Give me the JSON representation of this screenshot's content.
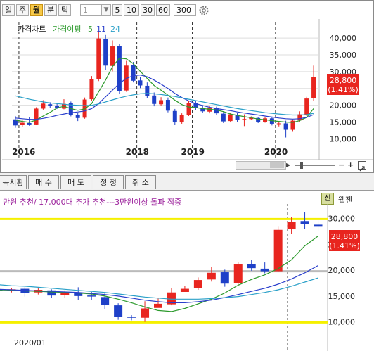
{
  "toolbar": {
    "periods": [
      "일",
      "주",
      "월",
      "분",
      "틱"
    ],
    "selected_period": "월",
    "unit_value": "1",
    "quick_units": [
      "5",
      "10",
      "30",
      "60"
    ],
    "count_value": "300"
  },
  "top_chart": {
    "legend": [
      {
        "label": "가격차트",
        "color": "#111111"
      },
      {
        "label": "가격이평",
        "color": "#2c9a2c"
      },
      {
        "label": "5",
        "color": "#2c9a2c"
      },
      {
        "label": "11",
        "color": "#2b3fcc"
      },
      {
        "label": "24",
        "color": "#2aa0c8"
      }
    ],
    "price_badge": "28,800",
    "change_badge": "(1.41%)"
  },
  "tabs": [
    "독시황",
    "매 수",
    "매 도",
    "정 정",
    "취 소"
  ],
  "bottom_panel": {
    "note": "만원 추천/ 17,000대 추가 추천---3만원이상 돌파 적중",
    "fav_label": "신",
    "web_label": "웹젠",
    "price_badge": "28,800",
    "change_badge": "(1.41%)"
  },
  "chart_data": [
    {
      "type": "candlestick",
      "title": "",
      "x_tick_labels": [
        "2016",
        "2018",
        "2019",
        "2020"
      ],
      "y_tick_labels": [
        "10,000",
        "15,000",
        "20,000",
        "25,000",
        "30,000",
        "35,000",
        "40,000"
      ],
      "ylim": [
        8000,
        44000
      ],
      "up_color": "#e8251f",
      "down_color": "#1e40c8",
      "candles": [
        [
          15800,
          14000,
          16800,
          13300
        ],
        [
          14200,
          14800,
          15700,
          13600
        ],
        [
          14700,
          14300,
          16400,
          13900
        ],
        [
          14300,
          19000,
          19400,
          14100
        ],
        [
          19000,
          20500,
          21500,
          18700
        ],
        [
          20300,
          19900,
          20900,
          19200
        ],
        [
          19800,
          19300,
          20500,
          18900
        ],
        [
          19000,
          20400,
          21800,
          18800
        ],
        [
          20700,
          17000,
          21100,
          16700
        ],
        [
          17100,
          16200,
          17800,
          15300
        ],
        [
          16300,
          21700,
          22300,
          16000
        ],
        [
          21800,
          27800,
          28700,
          21200
        ],
        [
          27700,
          39900,
          41900,
          27200
        ],
        [
          39800,
          31800,
          40900,
          30600
        ],
        [
          31700,
          37500,
          39300,
          30100
        ],
        [
          37600,
          24300,
          38200,
          23300
        ],
        [
          24400,
          31800,
          33200,
          24000
        ],
        [
          31900,
          27300,
          32900,
          26800
        ],
        [
          27400,
          25900,
          28300,
          25100
        ],
        [
          25800,
          22800,
          26800,
          22200
        ],
        [
          22900,
          20400,
          23800,
          19700
        ],
        [
          20300,
          21500,
          22400,
          19900
        ],
        [
          21600,
          18400,
          22300,
          17900
        ],
        [
          18300,
          14900,
          18900,
          14100
        ],
        [
          14900,
          17100,
          17600,
          14500
        ],
        [
          17200,
          20600,
          21300,
          16800
        ],
        [
          20700,
          19200,
          21500,
          18600
        ],
        [
          19300,
          18200,
          20100,
          17800
        ],
        [
          18100,
          19200,
          19800,
          17600
        ],
        [
          19100,
          17600,
          19600,
          17000
        ],
        [
          17500,
          15200,
          18200,
          14700
        ],
        [
          15300,
          17300,
          17800,
          14900
        ],
        [
          17200,
          15700,
          17800,
          15100
        ],
        [
          15600,
          15900,
          17300,
          13800
        ],
        [
          15900,
          16300,
          16700,
          15600
        ],
        [
          16200,
          15100,
          16500,
          14700
        ],
        [
          15000,
          16100,
          16600,
          14800
        ],
        [
          16100,
          14500,
          16400,
          14000
        ],
        [
          14500,
          14600,
          15300,
          13700
        ],
        [
          14600,
          12700,
          15400,
          10400
        ],
        [
          12700,
          15400,
          15800,
          12300
        ],
        [
          15500,
          17300,
          18200,
          15000
        ],
        [
          17200,
          22000,
          22500,
          16800
        ],
        [
          22100,
          28400,
          31800,
          21300
        ]
      ],
      "ma5": [
        15600,
        15200,
        14900,
        15600,
        16800,
        17900,
        19200,
        19700,
        19000,
        18500,
        18900,
        20500,
        24000,
        27500,
        31500,
        34000,
        33800,
        32400,
        30100,
        28000,
        25900,
        24500,
        23000,
        21500,
        20200,
        19500,
        19300,
        19000,
        18800,
        18600,
        18100,
        17400,
        17000,
        16600,
        16300,
        15900,
        15700,
        15400,
        15200,
        15000,
        14900,
        15400,
        16400,
        19000
      ],
      "ma11": [
        16200,
        16000,
        15800,
        15800,
        16100,
        16500,
        17000,
        17400,
        17800,
        18000,
        18300,
        19000,
        20500,
        22500,
        24500,
        26500,
        28000,
        28800,
        29000,
        28500,
        27500,
        26300,
        25000,
        23500,
        22300,
        21300,
        20500,
        19900,
        19400,
        19000,
        18700,
        18400,
        18000,
        17700,
        17400,
        17100,
        16800,
        16500,
        16200,
        16000,
        15900,
        16000,
        16400,
        17200
      ],
      "ma24": [
        22800,
        22300,
        21800,
        21400,
        21000,
        20700,
        20500,
        20300,
        20100,
        20000,
        19900,
        20000,
        20400,
        21000,
        21600,
        22200,
        22700,
        23100,
        23400,
        23500,
        23400,
        23200,
        22900,
        22600,
        22200,
        21800,
        21400,
        21000,
        20600,
        20200,
        19800,
        19400,
        19000,
        18700,
        18400,
        18100,
        17800,
        17600,
        17400,
        17200,
        17100,
        17100,
        17200,
        17600
      ]
    },
    {
      "type": "candlestick",
      "title": "",
      "x_tick_labels": [
        "2020/01"
      ],
      "y_tick_labels": [
        "10,000",
        "15,000",
        "20,000",
        "25,000",
        "30,000"
      ],
      "ylim": [
        7500,
        32800
      ],
      "up_color": "#e8251f",
      "down_color": "#1e40c8",
      "guide_lines": [
        {
          "value": 29900,
          "color": "#f5f000"
        },
        {
          "value": 19800,
          "color": "#bbbbbb"
        },
        {
          "value": 9900,
          "color": "#f5f000"
        }
      ],
      "candles": [
        [
          16200,
          16000,
          16600,
          15300
        ],
        [
          16000,
          16300,
          16500,
          15700
        ],
        [
          16400,
          15600,
          16700,
          14900
        ],
        [
          15700,
          16200,
          16500,
          15300
        ],
        [
          16100,
          15100,
          16300,
          14700
        ],
        [
          15200,
          15800,
          16100,
          14600
        ],
        [
          15700,
          15000,
          16700,
          14300
        ],
        [
          15100,
          14900,
          15800,
          14300
        ],
        [
          14800,
          13300,
          15600,
          12500
        ],
        [
          13200,
          11000,
          13600,
          10400
        ],
        [
          11000,
          10800,
          11300,
          10300
        ],
        [
          10800,
          12600,
          14000,
          10000
        ],
        [
          12700,
          13500,
          14500,
          12800
        ],
        [
          13400,
          15700,
          16600,
          13200
        ],
        [
          15800,
          16400,
          17000,
          15900
        ],
        [
          16500,
          18100,
          18600,
          16200
        ],
        [
          18200,
          19500,
          20600,
          17800
        ],
        [
          19600,
          17400,
          20100,
          16800
        ],
        [
          17500,
          21100,
          21500,
          17000
        ],
        [
          21200,
          20400,
          22000,
          19900
        ],
        [
          20300,
          19800,
          21500,
          19400
        ],
        [
          19800,
          27800,
          28400,
          19700
        ],
        [
          27900,
          29400,
          30300,
          27000
        ],
        [
          29500,
          28900,
          31200,
          28000
        ],
        [
          28800,
          28400,
          29600,
          27500
        ]
      ],
      "ma5": [
        16100,
        16100,
        16000,
        15900,
        15800,
        15700,
        15600,
        15400,
        15000,
        14400,
        13700,
        12900,
        12200,
        12000,
        12600,
        13500,
        14400,
        15600,
        17100,
        18200,
        19100,
        20300,
        22000,
        24700,
        26600
      ],
      "ma11": [
        16300,
        16200,
        16100,
        16000,
        15900,
        15800,
        15700,
        15500,
        15300,
        15000,
        14600,
        14200,
        13900,
        13700,
        13700,
        13900,
        14200,
        14700,
        15300,
        15900,
        16500,
        17300,
        18300,
        19500,
        20900
      ],
      "ma24": [
        17200,
        17000,
        16900,
        16700,
        16500,
        16300,
        16100,
        15900,
        15700,
        15400,
        15100,
        14800,
        14600,
        14400,
        14400,
        14400,
        14500,
        14700,
        14900,
        15300,
        15700,
        16200,
        16900,
        17700,
        18500
      ]
    }
  ]
}
